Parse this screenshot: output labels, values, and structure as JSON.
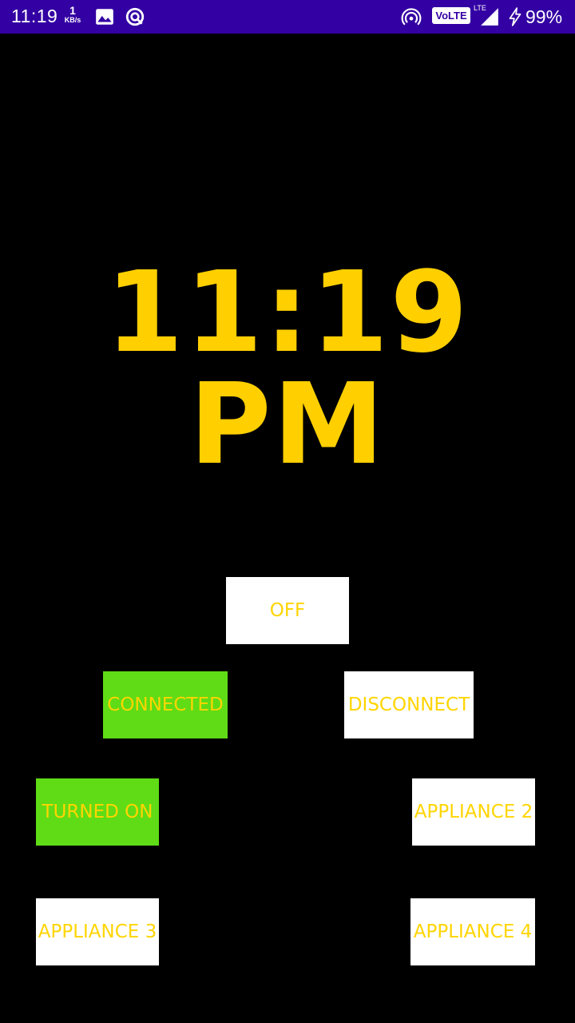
{
  "status_bar": {
    "time": "11:19",
    "net_speed_value": "1",
    "net_speed_unit": "KB/s",
    "volte": "VoLTE",
    "lte": "LTE",
    "battery": "99%",
    "icons": [
      "image-icon",
      "sync-icon",
      "hotspot-icon",
      "signal-icon",
      "charging-icon"
    ]
  },
  "clock": {
    "text": "11:19 PM",
    "color": "#ffcf00"
  },
  "buttons": {
    "master": "OFF",
    "connect": "CONNECTED",
    "disconnect": "DISCONNECT",
    "appliance1": "TURNED ON",
    "appliance2": "APPLIANCE 2",
    "appliance3": "APPLIANCE 3",
    "appliance4": "APPLIANCE 4"
  },
  "colors": {
    "status_bar": "#3300a3",
    "button_active": "#5fdc16",
    "button_inactive": "#ffffff",
    "button_text": "#ffd500"
  }
}
